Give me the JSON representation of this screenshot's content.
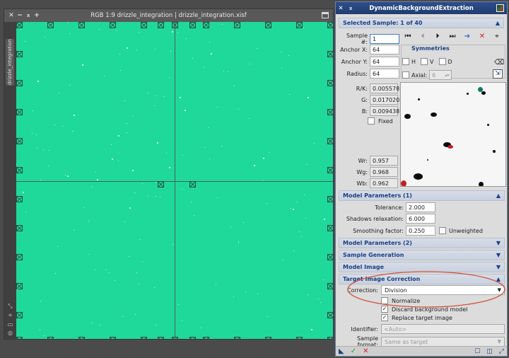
{
  "image_window": {
    "controls": [
      "✕",
      "−",
      "⌅",
      "+"
    ],
    "title": "RGB 1:9 drizzle_integration | drizzle_integration.xisf",
    "side_tab": "drizzle_integration",
    "canvas_color": "#1fd99a"
  },
  "panel": {
    "controls": [
      "✕",
      "⌅"
    ],
    "title": "DynamicBackgroundExtraction",
    "selected_sample": {
      "header": "Selected Sample: 1 of 40",
      "sample_label": "Sample #:",
      "sample_value": "1",
      "anchor_x_label": "Anchor X:",
      "anchor_x": "64",
      "anchor_y_label": "Anchor Y:",
      "anchor_y": "64",
      "radius_label": "Radius:",
      "radius": "64",
      "symmetries_label": "Symmetries",
      "h_label": "H",
      "v_label": "V",
      "d_label": "D",
      "axial_label": "Axial:",
      "axial_value": "6",
      "rk_label": "R/K:",
      "rk": "0.005578",
      "g_label": "G:",
      "g": "0.017020",
      "b_label": "B:",
      "b": "0.009438",
      "fixed_label": "Fixed",
      "wr_label": "Wr:",
      "wr": "0.957",
      "wg_label": "Wg:",
      "wg": "0.968",
      "wb_label": "Wb:",
      "wb": "0.962"
    },
    "model_params_1": {
      "header": "Model Parameters (1)",
      "tolerance_label": "Tolerance:",
      "tolerance": "2.000",
      "shadows_label": "Shadows relaxation:",
      "shadows": "6.000",
      "smoothing_label": "Smoothing factor:",
      "smoothing": "0.250",
      "unweighted_label": "Unweighted"
    },
    "model_params_2": {
      "header": "Model Parameters (2)"
    },
    "sample_generation": {
      "header": "Sample Generation"
    },
    "model_image": {
      "header": "Model Image"
    },
    "target_correction": {
      "header": "Target Image Correction",
      "correction_label": "Correction:",
      "correction_value": "Division",
      "normalize_label": "Normalize",
      "discard_label": "Discard background model",
      "replace_label": "Replace target image",
      "identifier_label": "Identifier:",
      "identifier_placeholder": "<Auto>",
      "format_label": "Sample format:",
      "format_value": "Same as target"
    },
    "annotation_color": "#d0533a"
  }
}
